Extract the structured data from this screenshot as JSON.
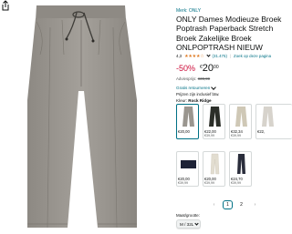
{
  "product": {
    "brand": "Merk: ONLY",
    "title_lines": [
      "ONLY Dames Modieuze Broek",
      "Poptrash Paperback Stretch",
      "Broek Zakelijke Broek",
      "ONLPOPTRASH NIEUW"
    ],
    "rating_value": "4,3",
    "stars": "★★★★☆",
    "rating_count": "31.475",
    "search_link": "Zoek op deze pagina",
    "discount": "-50%",
    "price_currency": "€",
    "price_whole": "20",
    "price_fraction": "00",
    "list_price_label": "Adviesprijs:",
    "list_price_value": "€39,99",
    "returns_label": "Gratis retourneren",
    "incl_vat": "Prijzen zijn inclusief btw.",
    "color_label": "Kleur:",
    "color_value": "Rock Ridge"
  },
  "swatches_row1": [
    {
      "price": "€20,00",
      "sub": "",
      "selected": true,
      "color": "#9a968f"
    },
    {
      "price": "€22,00",
      "sub": "€39,99",
      "selected": false,
      "color": "#2b2e28"
    },
    {
      "price": "€32,34",
      "sub": "€39,99",
      "selected": false,
      "color": "#cfc8b6"
    },
    {
      "price": "€22,",
      "sub": "",
      "selected": false,
      "color": "#d7d3cc"
    }
  ],
  "swatches_row2": [
    {
      "price": "€20,00",
      "sub": "€39,99",
      "selected": false,
      "color": "#1d2236"
    },
    {
      "price": "€20,00",
      "sub": "€39,99",
      "selected": false,
      "color": "#e2ddd0"
    },
    {
      "price": "€24,70",
      "sub": "€39,99",
      "selected": false,
      "color": "#2a2d3b"
    }
  ],
  "pager": {
    "prev": "‹",
    "pages": [
      "1",
      "2"
    ],
    "current": "1",
    "next": "›"
  },
  "size": {
    "label": "Maat/grootte:",
    "value": "M / 32L"
  }
}
